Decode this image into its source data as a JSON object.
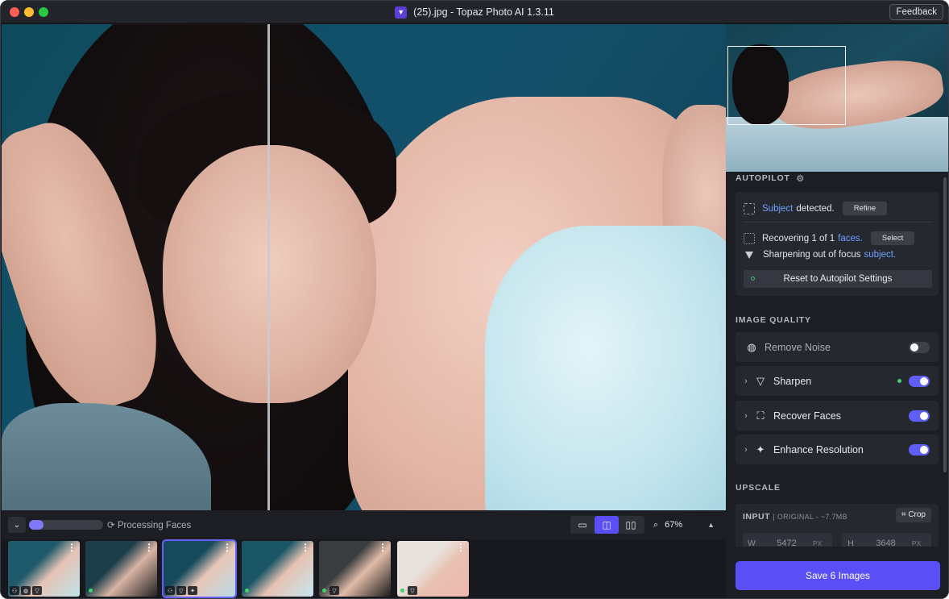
{
  "window": {
    "title": "(25).jpg - Topaz Photo AI 1.3.11",
    "feedback_label": "Feedback"
  },
  "autopilot": {
    "section_title": "AUTOPILOT",
    "subject_link": "Subject",
    "subject_detected": "detected.",
    "refine_label": "Refine",
    "recovering_prefix": "Recovering 1 of 1",
    "faces_link": "faces.",
    "select_label": "Select",
    "sharpening_prefix": "Sharpening out of focus",
    "sharpening_link": "subject.",
    "reset_label": "Reset to Autopilot Settings"
  },
  "image_quality": {
    "section_title": "IMAGE QUALITY",
    "tools": [
      {
        "label": "Remove Noise",
        "icon": "noise-icon",
        "enabled": false,
        "expandable": false
      },
      {
        "label": "Sharpen",
        "icon": "sharpen-icon",
        "enabled": true,
        "expandable": true,
        "modified": true
      },
      {
        "label": "Recover Faces",
        "icon": "face-icon",
        "enabled": true,
        "expandable": true
      },
      {
        "label": "Enhance Resolution",
        "icon": "sparkle-icon",
        "enabled": true,
        "expandable": true
      }
    ]
  },
  "upscale": {
    "section_title": "UPSCALE",
    "input_label": "INPUT",
    "input_sub": "| ORIGINAL - ~7.7MB",
    "crop_label": "Crop",
    "width_key": "W",
    "width_value": "5472",
    "height_key": "H",
    "height_value": "3648",
    "unit": "PX"
  },
  "save_label": "Save 6 Images",
  "bottom_bar": {
    "progress_fraction": 0.2,
    "processing_text": "Processing Faces",
    "zoom_value": "67%"
  },
  "colors": {
    "accent": "#5a4ff7",
    "link": "#6fa0ff",
    "status_green": "#3fd36a"
  },
  "filmstrip": [
    {
      "selected": false,
      "scene": [
        "#1e5a6b",
        "#bfe3ea",
        "#e6c3b4"
      ],
      "badges": [
        "people",
        "noise",
        "sharpen"
      ],
      "dot": false
    },
    {
      "selected": false,
      "scene": [
        "#1b3e4a",
        "#222",
        "#d9b3a3"
      ],
      "badges": [],
      "dot": true
    },
    {
      "selected": true,
      "scene": [
        "#15495c",
        "#b8dbe6",
        "#e9c6b7"
      ],
      "badges": [
        "people",
        "sharpen",
        "sparkle"
      ],
      "dot": false
    },
    {
      "selected": false,
      "scene": [
        "#1a5566",
        "#c6e6ee",
        "#e6c2b3"
      ],
      "badges": [],
      "dot": true
    },
    {
      "selected": false,
      "scene": [
        "#3a3d40",
        "#1a1a1a",
        "#e2bca9"
      ],
      "badges": [
        "sharpen"
      ],
      "dot": true
    },
    {
      "selected": false,
      "scene": [
        "#e9e3df",
        "#f2b7b0",
        "#e7c2b2"
      ],
      "badges": [
        "sharpen"
      ],
      "dot": true
    }
  ]
}
